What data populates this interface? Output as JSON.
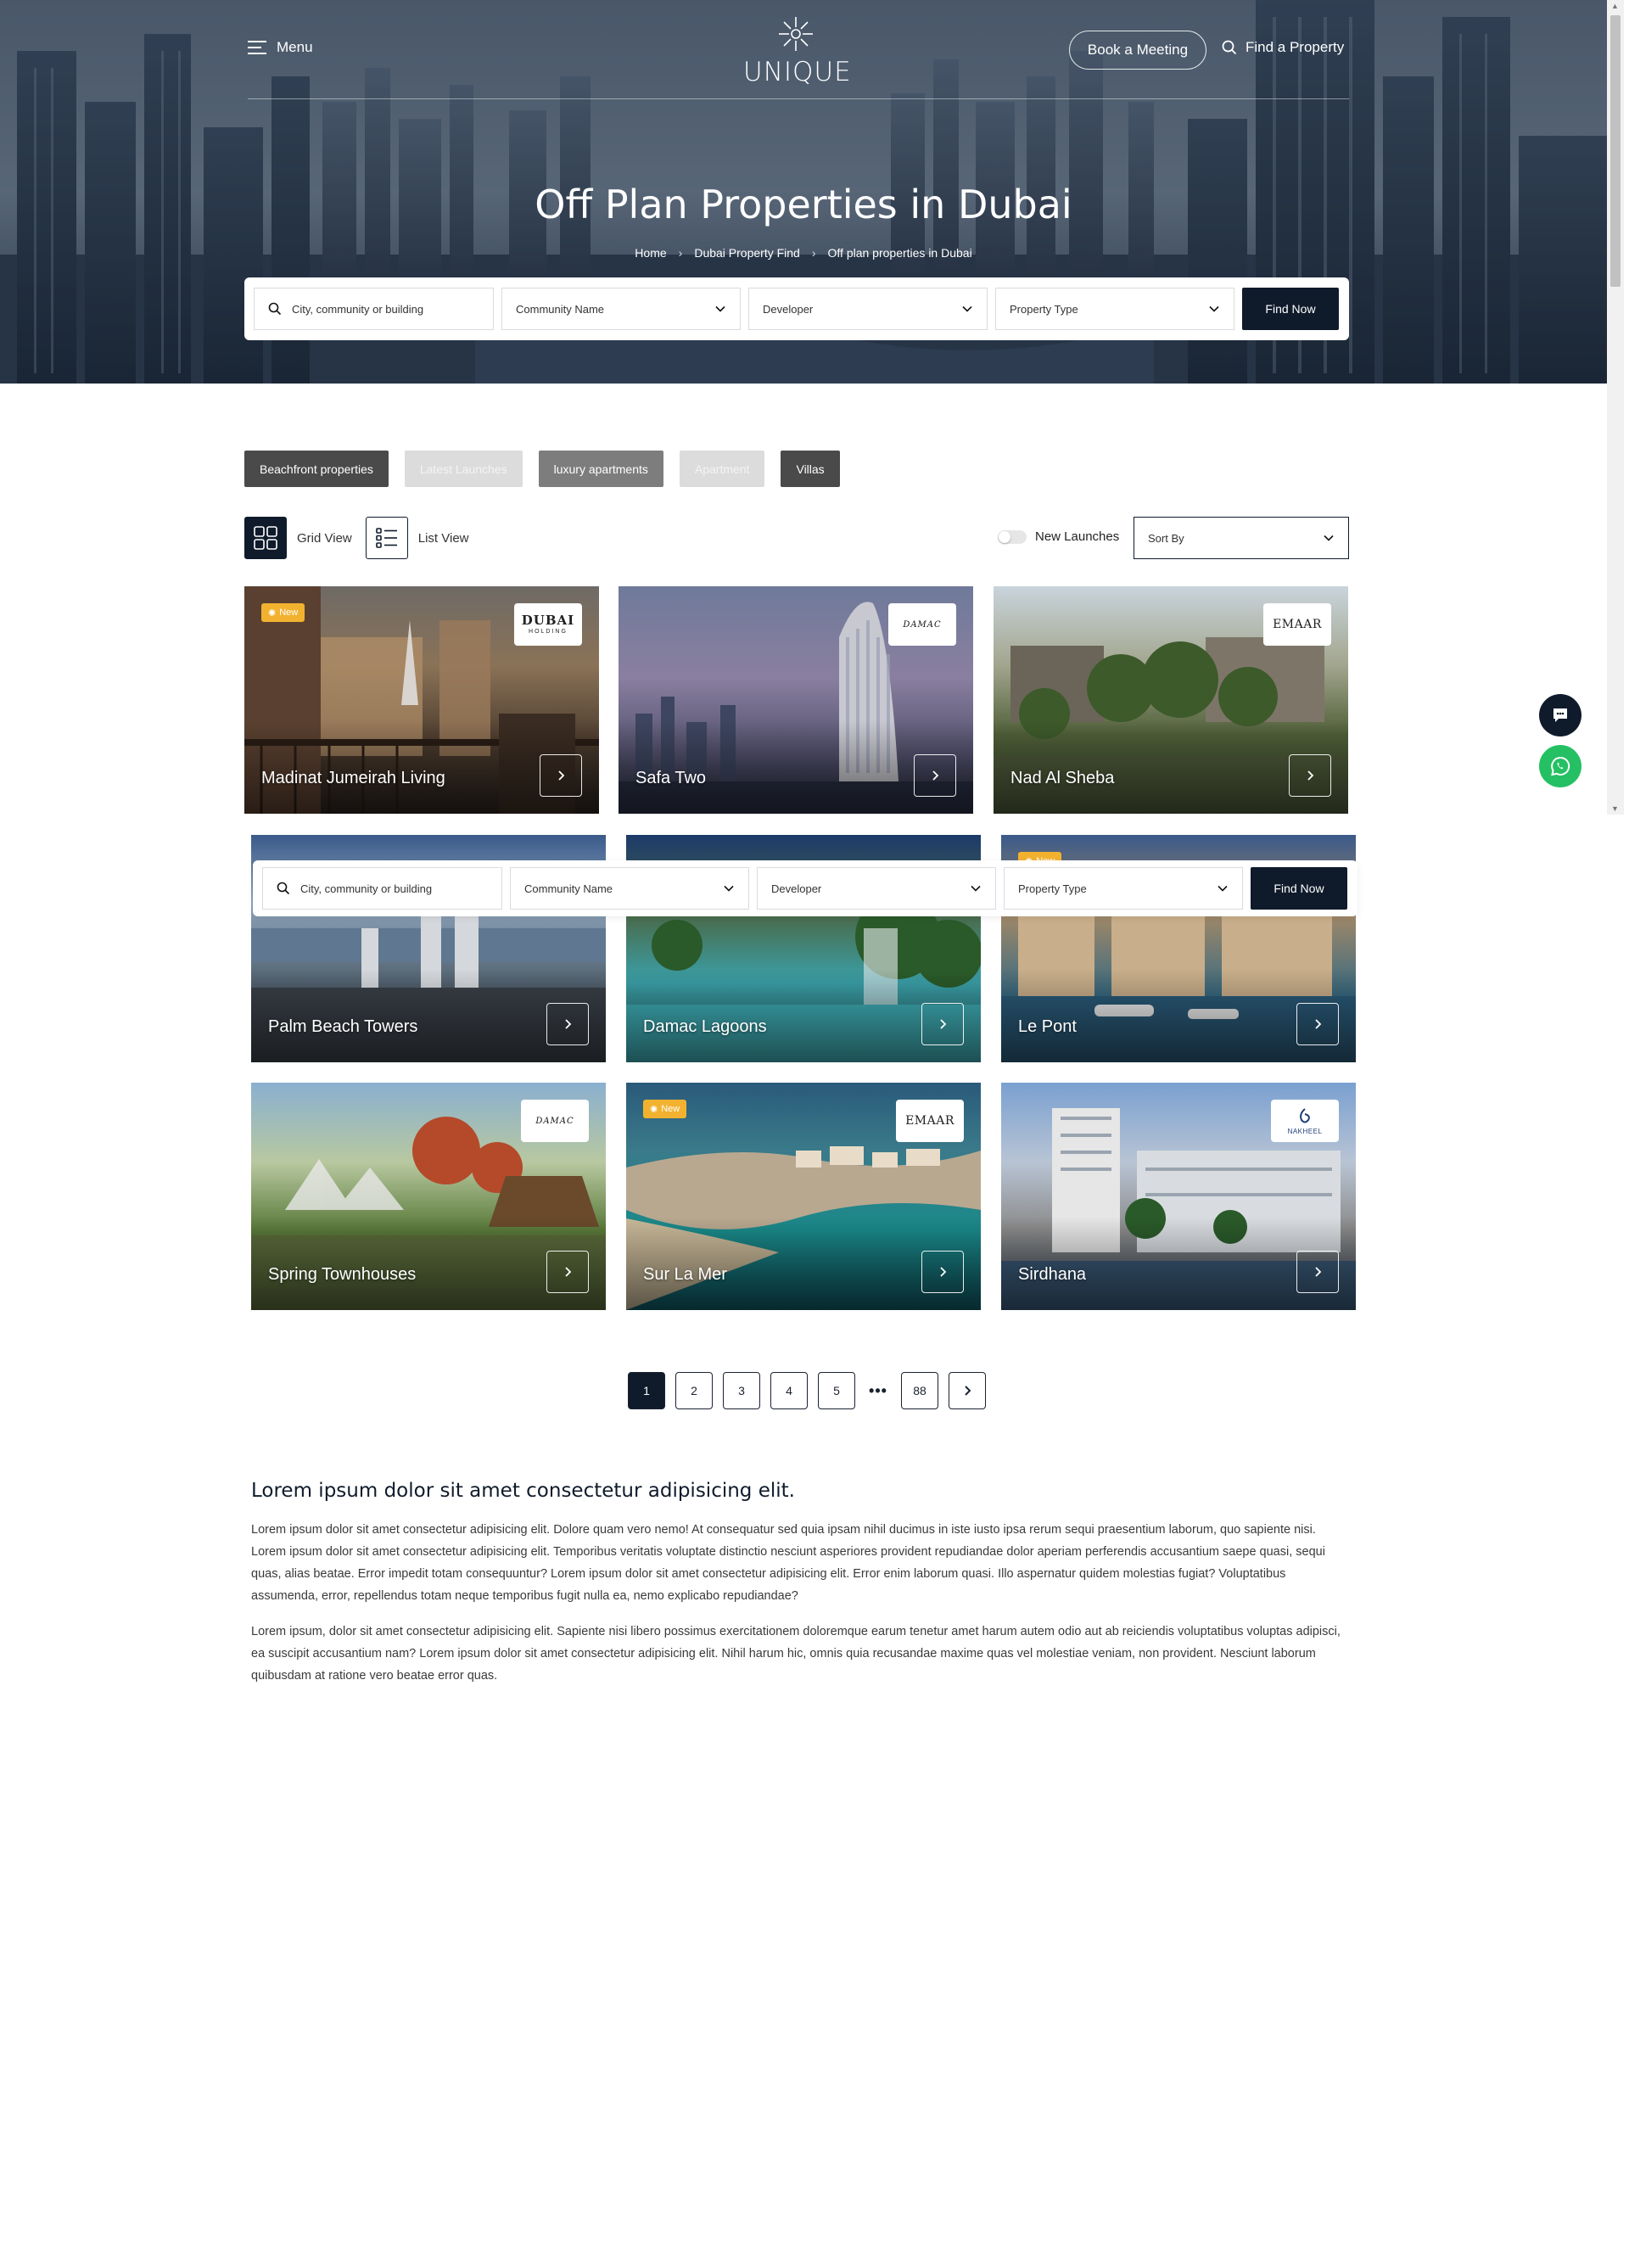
{
  "header": {
    "menu_label": "Menu",
    "logo_text": "UNIQUE",
    "book_meeting": "Book a Meeting",
    "find_property": "Find a Property"
  },
  "hero": {
    "title": "Off Plan Properties in Dubai",
    "breadcrumb": [
      "Home",
      "Dubai Property Find",
      "Off plan properties in Dubai"
    ]
  },
  "search": {
    "location_placeholder": "City, community or building",
    "community": "Community Name",
    "developer": "Developer",
    "property_type": "Property Type",
    "find_button": "Find Now"
  },
  "filters": [
    {
      "label": "Beachfront properties",
      "state": "dark"
    },
    {
      "label": "Latest Launches",
      "state": "light"
    },
    {
      "label": "luxury apartments",
      "state": "mid"
    },
    {
      "label": "Apartment",
      "state": "light"
    },
    {
      "label": "Villas",
      "state": "dark"
    }
  ],
  "view": {
    "grid_label": "Grid View",
    "list_label": "List View",
    "new_launches_label": "New Launches",
    "sort_label": "Sort By"
  },
  "new_badge_label": "New",
  "cards": [
    {
      "title": "Madinat Jumeirah Living",
      "developer": "DUBAI HOLDING",
      "dev_top": "DUBAI",
      "dev_bottom": "HOLDING",
      "is_new": true
    },
    {
      "title": "Safa Two",
      "developer": "DAMAC",
      "is_new": false
    },
    {
      "title": "Nad Al Sheba",
      "developer": "EMAAR",
      "is_new": false
    },
    {
      "title": "Palm Beach Towers",
      "developer": "",
      "is_new": false
    },
    {
      "title": "Damac Lagoons",
      "developer": "",
      "is_new": false
    },
    {
      "title": "Le Pont",
      "developer": "",
      "is_new": true
    },
    {
      "title": "Spring Townhouses",
      "developer": "DAMAC",
      "is_new": false
    },
    {
      "title": "Sur La Mer",
      "developer": "EMAAR",
      "is_new": true
    },
    {
      "title": "Sirdhana",
      "developer": "NAKHEEL",
      "is_new": false
    }
  ],
  "pagination": {
    "pages": [
      "1",
      "2",
      "3",
      "4",
      "5"
    ],
    "current": "1",
    "last": "88"
  },
  "content": {
    "heading": "Lorem ipsum dolor sit amet consectetur adipisicing elit.",
    "paragraphs": [
      "Lorem ipsum dolor sit amet consectetur adipisicing elit. Dolore quam vero nemo! At consequatur sed quia ipsam nihil ducimus in iste iusto ipsa rerum sequi praesentium laborum, quo sapiente nisi. Lorem ipsum dolor sit amet consectetur adipisicing elit. Temporibus veritatis voluptate distinctio nesciunt asperiores provident repudiandae dolor aperiam perferendis accusantium saepe quasi, sequi quas, alias beatae. Error impedit totam consequuntur? Lorem ipsum dolor sit amet consectetur adipisicing elit. Error enim laborum quasi. Illo aspernatur quidem molestias fugiat? Voluptatibus assumenda, error, repellendus totam neque temporibus fugit nulla ea, nemo explicabo repudiandae?",
      "Lorem ipsum, dolor sit amet consectetur adipisicing elit. Sapiente nisi libero possimus exercitationem doloremque earum tenetur amet harum autem odio aut ab reiciendis voluptatibus voluptas adipisci, ea suscipit accusantium nam? Lorem ipsum dolor sit amet consectetur adipisicing elit. Nihil harum hic, omnis quia recusandae maxime quas vel molestiae veniam, non provident. Nesciunt laborum quibusdam at ratione vero beatae error quas."
    ]
  }
}
